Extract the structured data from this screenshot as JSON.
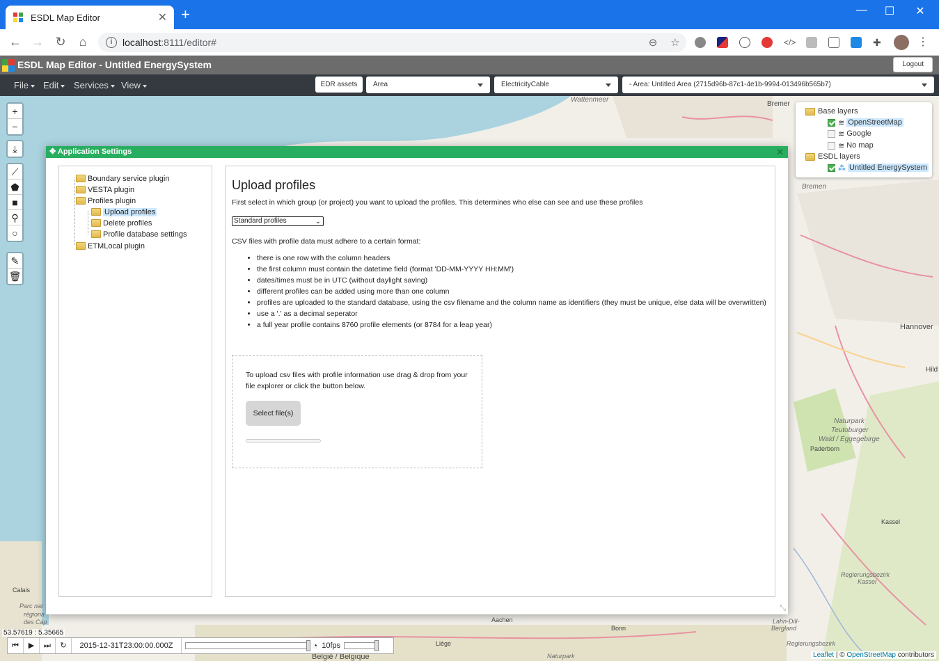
{
  "browser": {
    "tab_title": "ESDL Map Editor",
    "url_host": "localhost",
    "url_rest": ":8111/editor#"
  },
  "app": {
    "title": "ESDL Map Editor - Untitled EnergySystem",
    "logout_label": "Logout",
    "menus": [
      "File",
      "Edit",
      "Services",
      "View"
    ],
    "edr_label": "EDR assets",
    "select_area": "Area",
    "select_asset": "ElectricityCable",
    "select_area_path": "- Area: Untitled Area (2715d96b-87c1-4e1b-9994-013496b565b7)"
  },
  "layers": {
    "base_title": "Base layers",
    "base_items": [
      "OpenStreetMap",
      "Google",
      "No map"
    ],
    "esdl_title": "ESDL layers",
    "esdl_items": [
      "Untitled EnergySystem"
    ]
  },
  "dialog": {
    "title": "Application Settings",
    "tree": {
      "boundary": "Boundary service plugin",
      "vesta": "VESTA plugin",
      "profiles": "Profiles plugin",
      "upload": "Upload profiles",
      "delete": "Delete profiles",
      "dbsettings": "Profile database settings",
      "etm": "ETMLocal plugin"
    },
    "heading": "Upload profiles",
    "intro": "First select in which group (or project) you want to upload the profiles. This determines who else can see and use these profiles",
    "group_value": "Standard profiles",
    "format_intro": "CSV files with profile data must adhere to a certain format:",
    "rules": [
      "there is one row with the column headers",
      "the first column must contain the datetime field (format 'DD-MM-YYYY HH:MM')",
      "dates/times must be in UTC (without daylight saving)",
      "different profiles can be added using more than one column",
      "profiles are uploaded to the standard database, using the csv filename and the column name as identifiers (they must be unique, else data will be overwritten)",
      "use a '.' as a decimal seperator",
      "a full year profile contains 8760 profile elements (or 8784 for a leap year)"
    ],
    "drop_text": "To upload csv files with profile information use drag & drop from your file explorer or click the button below.",
    "select_files_label": "Select file(s)"
  },
  "map": {
    "coords": "53.57619 : 5.35665",
    "time": "2015-12-31T23:00:00.000Z",
    "fps": "10fps",
    "attribution_leaflet": "Leaflet",
    "attribution_sep": " | © ",
    "attribution_osm": "OpenStreetMap",
    "attribution_tail": " contributors",
    "labels": {
      "wattenmeer": "Wattenmeer",
      "bremer": "Bremer",
      "bremen": "Bremen",
      "hannover": "Hannover",
      "naturpark": "Naturpark",
      "teutoburger": "Teutoburger",
      "wald": "Wald / Eggegebirge",
      "paderborn": "Paderborn",
      "kassel": "Kassel",
      "calais": "Calais",
      "aachen": "Aachen",
      "bonn": "Bonn",
      "belgie": "België / Belgique",
      "liege": "Liège",
      "hild": "Hild",
      "lahn": "Lahn-Dill-",
      "bergland": "Bergland",
      "regbez": "Regierungsbezirk",
      "kassel2": "Kassel",
      "parc": "Parc nat",
      "region": "régiona",
      "caps": "des Cap",
      "naturpark2": "Naturpark",
      "regbez2": "Regierungsbezirk"
    }
  },
  "colors": {
    "brand_green": "#27ae60",
    "chrome_blue": "#1a73e8",
    "navbar": "#343a40",
    "header": "#6c6c6c"
  }
}
